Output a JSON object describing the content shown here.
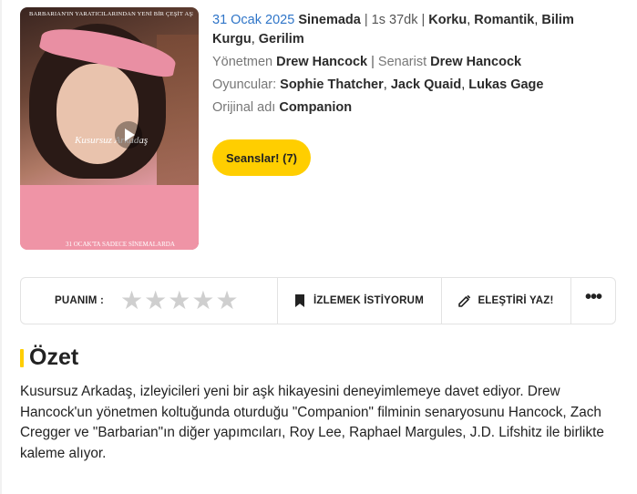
{
  "poster": {
    "top_text": "BARBARIAN'IN YARATICILARINDAN YENİ BİR ÇEŞİT AŞK HİKAYESİ",
    "title": "Kusursuz Arkadaş",
    "bottom_text": "31 OCAK'TA SADECE SİNEMALARDA",
    "play_icon": "play-icon"
  },
  "info": {
    "release_date": "31 Ocak 2025",
    "release_status": "Sinemada",
    "duration": "1s 37dk",
    "genres": [
      "Korku",
      "Romantik",
      "Bilim Kurgu",
      "Gerilim"
    ],
    "director_label": "Yönetmen",
    "director": "Drew Hancock",
    "writer_label": "Senarist",
    "writer": "Drew Hancock",
    "cast_label": "Oyuncular:",
    "cast": [
      "Sophie Thatcher",
      "Jack Quaid",
      "Lukas Gage"
    ],
    "original_title_label": "Orijinal adı",
    "original_title": "Companion"
  },
  "seanslar_button": "Seanslar! (7)",
  "action_bar": {
    "rating_label": "PUANIM :",
    "rating_stars_total": 5,
    "rating_value": 0,
    "watchlist_label": "İZLEMEK İSTİYORUM",
    "review_label": "ELEŞTİRİ YAZ!",
    "more_label": "•••"
  },
  "summary": {
    "heading": "Özet",
    "text": "Kusursuz Arkadaş, izleyicileri yeni bir aşk hikayesini deneyimlemeye davet ediyor. Drew Hancock'un yönetmen koltuğunda oturduğu \"Companion\" filminin senaryosunu Hancock, Zach Cregger ve \"Barbarian\"ın diğer yapımcıları, Roy Lee, Raphael Margules, J.D. Lifshitz ile birlikte kaleme alıyor."
  },
  "colors": {
    "accent": "#ffce00",
    "date_link": "#2f75c8",
    "star_empty": "#cfcfcf"
  }
}
